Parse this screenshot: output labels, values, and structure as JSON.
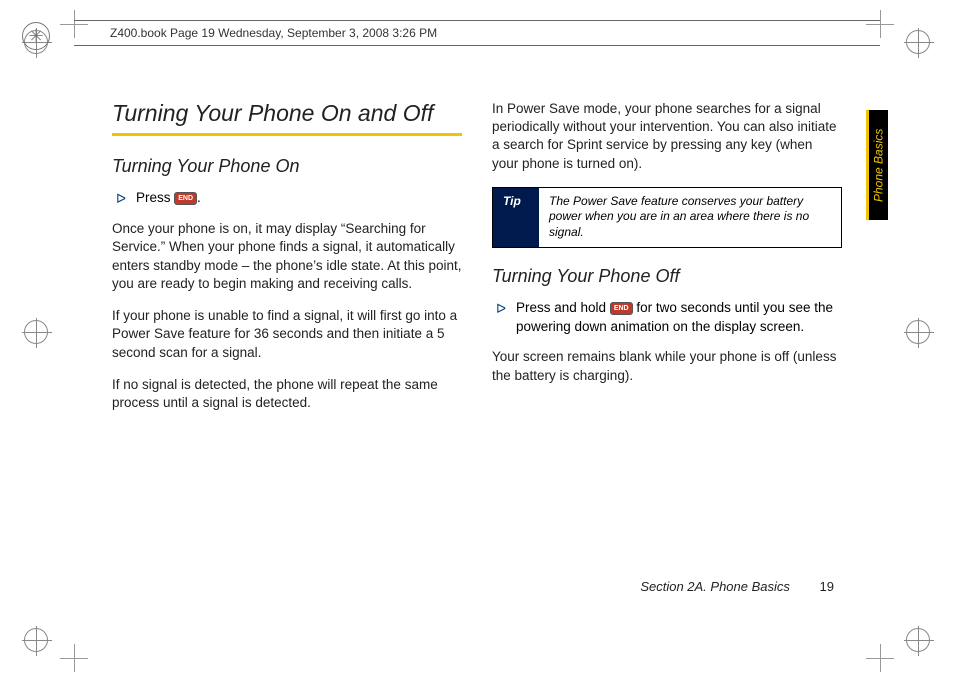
{
  "header": {
    "file_info": "Z400.book  Page 19  Wednesday, September 3, 2008  3:26 PM"
  },
  "side_tab": "Phone Basics",
  "left": {
    "title": "Turning Your Phone On and Off",
    "sub1": "Turning Your Phone On",
    "step1_prefix": "Press ",
    "step1_suffix": ".",
    "p1": "Once your phone is on, it may display “Searching for Service.” When your phone finds a signal, it automatically enters standby mode – the phone’s idle state. At this point, you are ready to begin making and receiving calls.",
    "p2": "If your phone is unable to find a signal, it will first go into a Power Save feature for 36 seconds and then initiate a 5 second scan for a signal.",
    "p3": "If no signal is detected, the phone will repeat the same process until a signal is detected."
  },
  "right": {
    "p1": "In Power Save mode, your phone searches for a signal periodically without your intervention. You can also initiate a search for Sprint service by pressing any key (when your phone is turned on).",
    "tip_label": "Tip",
    "tip_text": "The Power Save feature conserves your battery power when you are in an area where there is no signal.",
    "sub2": "Turning Your Phone Off",
    "step2_prefix": "Press and hold ",
    "step2_suffix": " for two seconds until you see the powering down animation on the display screen.",
    "p2": "Your screen remains blank while your phone is off (unless the battery is charging)."
  },
  "end_key_label": "END",
  "footer": {
    "section": "Section 2A. Phone Basics",
    "page": "19"
  }
}
